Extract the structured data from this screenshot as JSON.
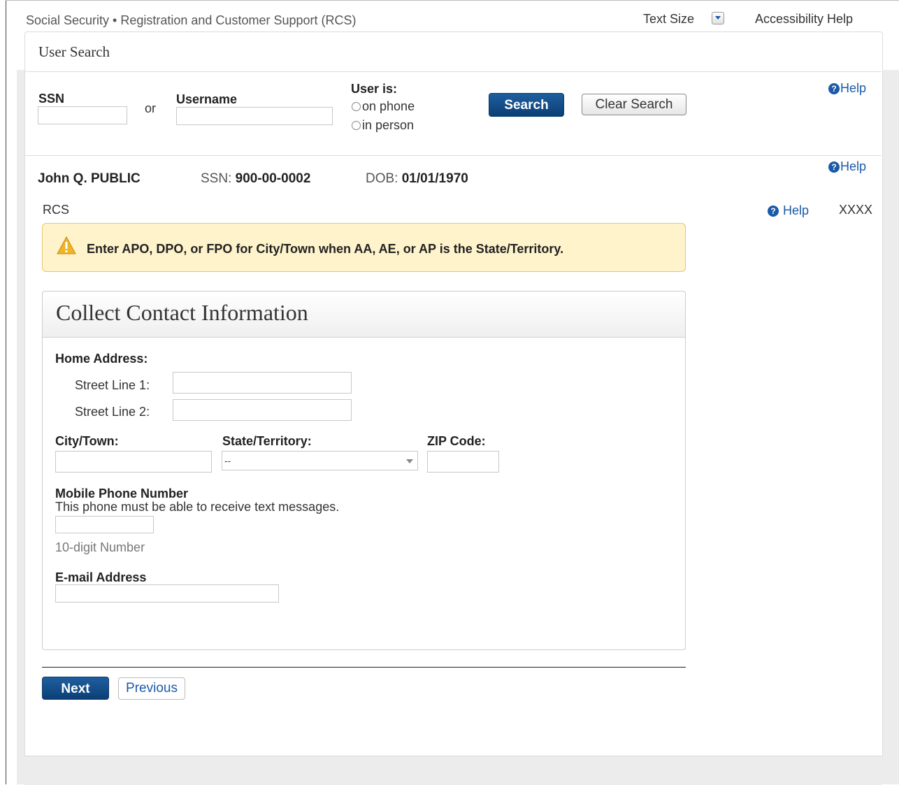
{
  "header": {
    "app_title": "Social Security • Registration and Customer Support (RCS)",
    "text_size_label": "Text Size",
    "accessibility_help": "Accessibility Help"
  },
  "user_search": {
    "title": "User Search",
    "ssn_label": "SSN",
    "or_label": "or",
    "username_label": "Username",
    "user_is_label": "User is:",
    "options": [
      "on phone",
      "in person"
    ],
    "search_button": "Search",
    "clear_button": "Clear Search",
    "help_label": "Help"
  },
  "person": {
    "name": "John Q. PUBLIC",
    "ssn_label": "SSN:",
    "ssn_value": "900-00-0002",
    "dob_label": "DOB:",
    "dob_value": "01/01/1970",
    "help_label": "Help"
  },
  "section": {
    "label": "RCS",
    "help_label": "Help",
    "code": "XXXX"
  },
  "alert": {
    "message": "Enter APO, DPO, or FPO for City/Town when AA, AE, or AP is the State/Territory."
  },
  "form": {
    "title": "Collect Contact Information",
    "home_address_label": "Home Address:",
    "street1_label": "Street Line 1:",
    "street2_label": "Street Line 2:",
    "city_label": "City/Town:",
    "state_label": "State/Territory:",
    "state_selected": "--",
    "zip_label": "ZIP Code:",
    "mobile_label": "Mobile Phone Number",
    "mobile_hint": "This phone must be able to receive text messages.",
    "mobile_format": "10-digit Number",
    "email_label": "E-mail Address"
  },
  "nav": {
    "next_button": "Next",
    "previous_button": "Previous"
  },
  "colors": {
    "primary": "#0b3f75",
    "link": "#1a5aa8",
    "alert_bg": "#fff3cc"
  }
}
